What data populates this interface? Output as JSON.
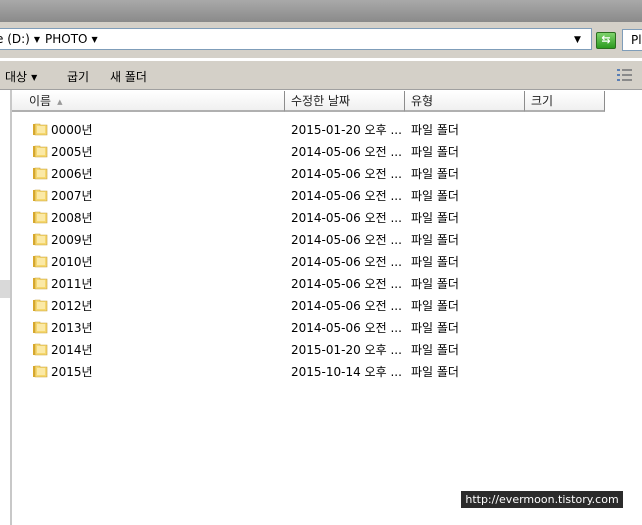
{
  "address": {
    "drive_crumb": "e (D:)",
    "folder_crumb": "PHOTO",
    "search_text": "Pl"
  },
  "toolbar": {
    "target_label": "대상",
    "burn_label": "굽기",
    "new_folder_label": "새 폴더"
  },
  "columns": {
    "name": "이름",
    "date": "수정한 날짜",
    "type": "유형",
    "size": "크기"
  },
  "files": [
    {
      "name": "0000년",
      "date": "2015-01-20 오후 ...",
      "type": "파일 폴더"
    },
    {
      "name": "2005년",
      "date": "2014-05-06 오전 ...",
      "type": "파일 폴더"
    },
    {
      "name": "2006년",
      "date": "2014-05-06 오전 ...",
      "type": "파일 폴더"
    },
    {
      "name": "2007년",
      "date": "2014-05-06 오전 ...",
      "type": "파일 폴더"
    },
    {
      "name": "2008년",
      "date": "2014-05-06 오전 ...",
      "type": "파일 폴더"
    },
    {
      "name": "2009년",
      "date": "2014-05-06 오전 ...",
      "type": "파일 폴더"
    },
    {
      "name": "2010년",
      "date": "2014-05-06 오전 ...",
      "type": "파일 폴더"
    },
    {
      "name": "2011년",
      "date": "2014-05-06 오전 ...",
      "type": "파일 폴더"
    },
    {
      "name": "2012년",
      "date": "2014-05-06 오전 ...",
      "type": "파일 폴더"
    },
    {
      "name": "2013년",
      "date": "2014-05-06 오전 ...",
      "type": "파일 폴더"
    },
    {
      "name": "2014년",
      "date": "2015-01-20 오후 ...",
      "type": "파일 폴더"
    },
    {
      "name": "2015년",
      "date": "2015-10-14 오후 ...",
      "type": "파일 폴더"
    }
  ],
  "watermark": "http://evermoon.tistory.com",
  "icons": {
    "folder": "folder-icon",
    "go": "refresh-go-icon",
    "view": "view-options-icon"
  },
  "colors": {
    "chrome": "#d4d0c8",
    "folder_yellow": "#f5d76e",
    "go_green": "#3aa82a"
  }
}
